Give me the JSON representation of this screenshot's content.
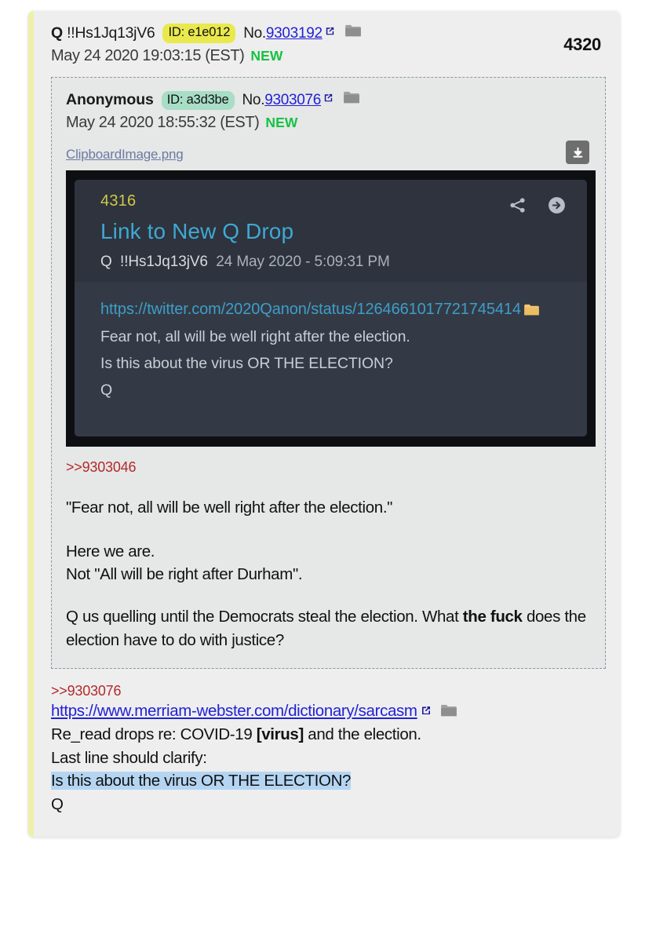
{
  "main_post": {
    "author": "Q",
    "tripcode": "!!Hs1Jq13jV6",
    "id_badge": "ID: e1e012",
    "no_label": "No.",
    "post_number": "9303192",
    "timestamp": "May 24 2020 19:03:15 (EST)",
    "new_badge": "NEW",
    "reply_count": "4320",
    "icons": {
      "external_link": "external-link-icon",
      "folder": "folder-icon"
    }
  },
  "quoted_post": {
    "author": "Anonymous",
    "id_badge": "ID: a3d3be",
    "no_label": "No.",
    "post_number": "9303076",
    "timestamp": "May 24 2020 18:55:32 (EST)",
    "new_badge": "NEW",
    "attachment": {
      "file_name": "ClipboardImage.png",
      "download_icon": "download-icon"
    },
    "embed": {
      "drop_number": "4316",
      "title": "Link to New Q Drop",
      "author": "Q",
      "tripcode": "!!Hs1Jq13jV6",
      "date": "24 May 2020 - 5:09:31 PM",
      "url": "https://twitter.com/2020Qanon/status/1264661017721745414",
      "line1": "Fear not, all will be well right after the election.",
      "line2": "Is this about the virus OR THE ELECTION?",
      "line3": "Q",
      "share_icon": "share-icon",
      "forward_icon": "arrow-right-circle-icon"
    },
    "quote_ref": ">>9303046",
    "paragraph1": "\"Fear not, all will be well right after the election.\"",
    "paragraph2_line1": "Here we are.",
    "paragraph2_line2": "Not \"All will be right after Durham\".",
    "paragraph3_part1": "Q us quelling until the Democrats steal the election. What ",
    "paragraph3_bold": "the fuck",
    "paragraph3_part2": " does the election have to do with justice?"
  },
  "reply_body": {
    "quote_ref": ">>9303076",
    "link": "https://www.merriam-webster.com/dictionary/sarcasm",
    "line1_part1": "Re_read drops re: COVID-19 ",
    "line1_bold": "[virus]",
    "line1_part2": " and the election.",
    "line2": "Last line should clarify:",
    "line3_highlighted": "Is this about the virus OR THE ELECTION?",
    "line4": "Q"
  },
  "colors": {
    "accent_yellow": "#eff0a8",
    "id_yellow": "#e9e94d",
    "id_green": "#a8ddc6",
    "link_blue": "#2121d6",
    "quote_red": "#b4292b",
    "new_green": "#16c243",
    "highlight_blue": "#b4d5f2",
    "embed_bg": "#343a45"
  }
}
